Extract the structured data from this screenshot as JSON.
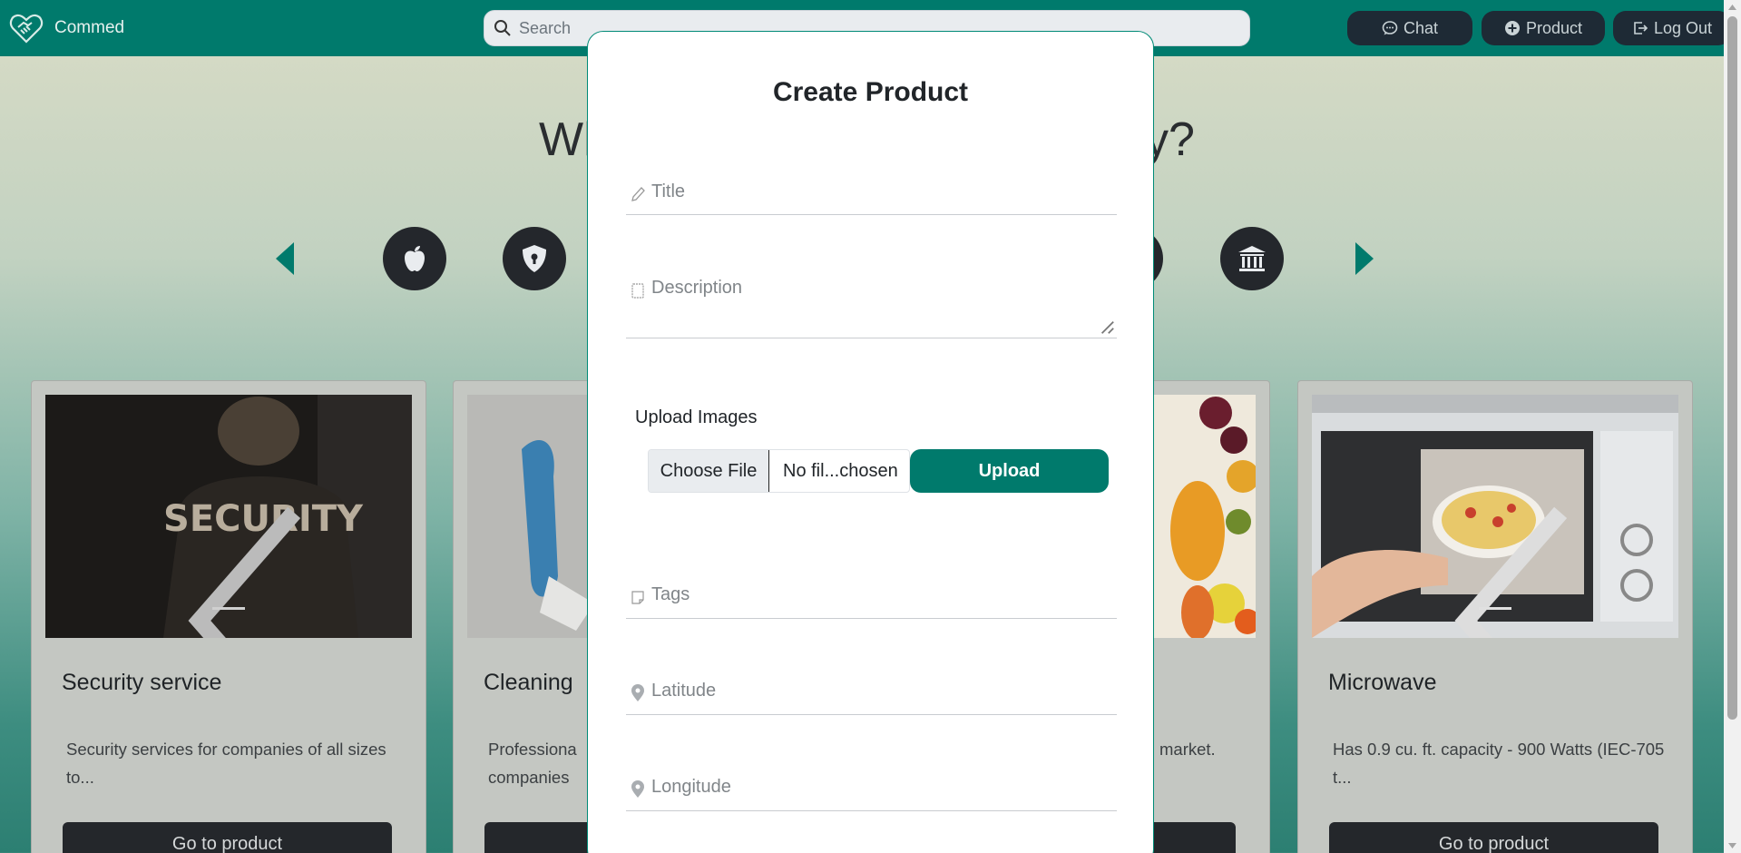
{
  "app": {
    "brand_name": "Commed",
    "search_placeholder": "Search",
    "nav": {
      "chat_label": "Chat",
      "product_label": "Product",
      "logout_label": "Log Out"
    }
  },
  "hero": {
    "question_visible_start": "Wh",
    "question_visible_end": "y?"
  },
  "categories": {
    "icons": [
      "apple-icon",
      "shield-lock-icon",
      "bank-icon"
    ]
  },
  "cards": [
    {
      "title": "Security service",
      "description": "Security services for companies of all sizes to...",
      "button_label": "Go to product",
      "image": "security-guard-photo"
    },
    {
      "title": "Cleaning",
      "description": "Professiona companies",
      "button_label": "",
      "image": "cleaning-gloves-photo"
    },
    {
      "title": "",
      "description": "market.",
      "button_label": "",
      "image": "fruits-photo"
    },
    {
      "title": "Microwave",
      "description": "Has 0.9 cu. ft. capacity - 900 Watts (IEC-705 t...",
      "button_label": "Go to product",
      "image": "microwave-pizza-photo"
    }
  ],
  "modal": {
    "title": "Create Product",
    "fields": {
      "title_placeholder": "Title",
      "description_placeholder": "Description",
      "tags_placeholder": "Tags",
      "latitude_placeholder": "Latitude",
      "longitude_placeholder": "Longitude"
    },
    "upload": {
      "label": "Upload Images",
      "choose_file_label": "Choose File",
      "file_name": "No fil...chosen",
      "upload_button_label": "Upload"
    }
  },
  "colors": {
    "primary": "#007a6c",
    "dark": "#24272b",
    "modal_border": "#008a76"
  }
}
